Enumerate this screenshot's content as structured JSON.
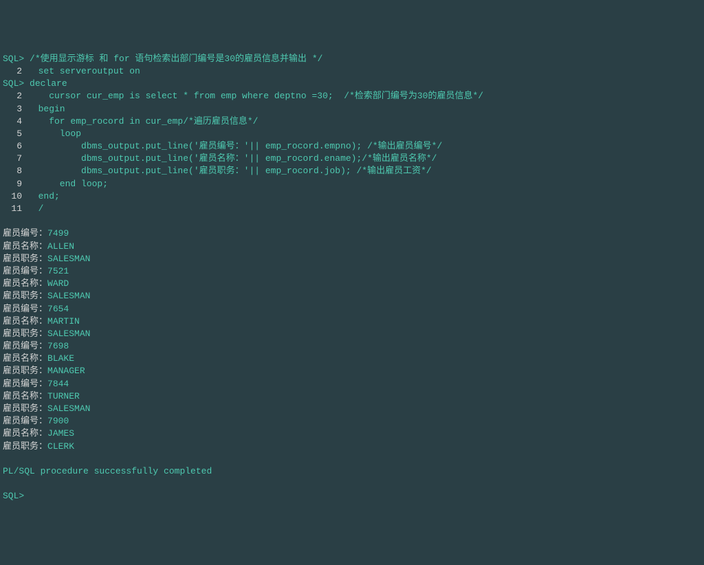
{
  "code": {
    "line1_prompt": "SQL>",
    "line1_text": " /*使用显示游标 和 for 语句检索出部门编号是30的雇员信息并输出 */",
    "line2_num": "2",
    "line2_text": "  set serveroutput on",
    "line3_prompt": "SQL>",
    "line3_text": " declare",
    "line4_num": "2",
    "line4_text": "    cursor cur_emp is select * from emp where deptno =30;  /*检索部门编号为30的雇员信息*/",
    "line5_num": "3",
    "line5_text": "  begin",
    "line6_num": "4",
    "line6_text": "    for emp_rocord in cur_emp/*遍历雇员信息*/",
    "line7_num": "5",
    "line7_text": "      loop",
    "line8_num": "6",
    "line8_text": "          dbms_output.put_line('雇员编号：'|| emp_rocord.empno); /*输出雇员编号*/",
    "line9_num": "7",
    "line9_text": "          dbms_output.put_line('雇员名称：'|| emp_rocord.ename);/*输出雇员名称*/",
    "line10_num": "8",
    "line10_text": "          dbms_output.put_line('雇员职务：'|| emp_rocord.job); /*输出雇员工资*/",
    "line11_num": "9",
    "line11_text": "      end loop;",
    "line12_num": "10",
    "line12_text": "  end;",
    "line13_num": "11",
    "line13_text": "  /"
  },
  "output": {
    "emp1_no_label": "雇员编号：",
    "emp1_no": "7499",
    "emp1_name_label": "雇员名称：",
    "emp1_name": "ALLEN",
    "emp1_job_label": "雇员职务：",
    "emp1_job": "SALESMAN",
    "emp2_no_label": "雇员编号：",
    "emp2_no": "7521",
    "emp2_name_label": "雇员名称：",
    "emp2_name": "WARD",
    "emp2_job_label": "雇员职务：",
    "emp2_job": "SALESMAN",
    "emp3_no_label": "雇员编号：",
    "emp3_no": "7654",
    "emp3_name_label": "雇员名称：",
    "emp3_name": "MARTIN",
    "emp3_job_label": "雇员职务：",
    "emp3_job": "SALESMAN",
    "emp4_no_label": "雇员编号：",
    "emp4_no": "7698",
    "emp4_name_label": "雇员名称：",
    "emp4_name": "BLAKE",
    "emp4_job_label": "雇员职务：",
    "emp4_job": "MANAGER",
    "emp5_no_label": "雇员编号：",
    "emp5_no": "7844",
    "emp5_name_label": "雇员名称：",
    "emp5_name": "TURNER",
    "emp5_job_label": "雇员职务：",
    "emp5_job": "SALESMAN",
    "emp6_no_label": "雇员编号：",
    "emp6_no": "7900",
    "emp6_name_label": "雇员名称：",
    "emp6_name": "JAMES",
    "emp6_job_label": "雇员职务：",
    "emp6_job": "CLERK"
  },
  "footer": {
    "completed": "PL/SQL procedure successfully completed",
    "final_prompt": "SQL>"
  }
}
